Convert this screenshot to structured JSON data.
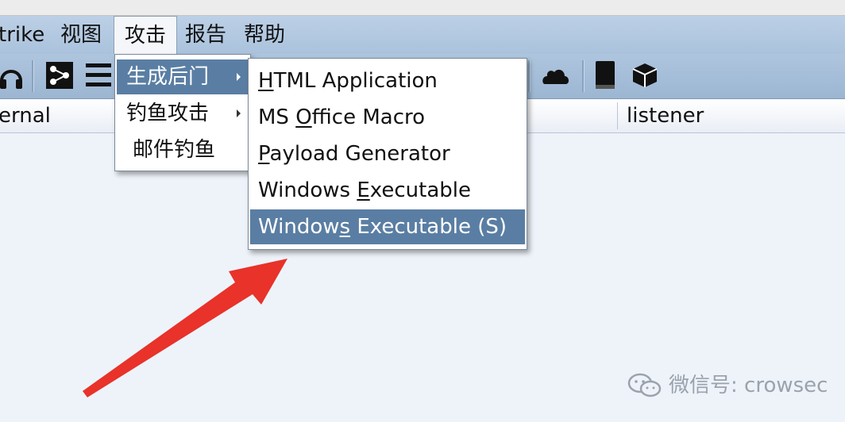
{
  "menubar": {
    "items": [
      {
        "label": "trike"
      },
      {
        "label": "视图"
      },
      {
        "label": "攻击"
      },
      {
        "label": "报告"
      },
      {
        "label": "帮助"
      }
    ]
  },
  "toolbar": {
    "icons": [
      "headset-icon",
      "network-graph-icon",
      "list-icon",
      "terminal-icon",
      "link-icon",
      "cloud-icon",
      "book-icon",
      "cube-icon"
    ]
  },
  "table": {
    "columns": [
      "ernal",
      "listener"
    ]
  },
  "attack_menu": {
    "items": [
      {
        "label": "生成后门",
        "has_submenu": true,
        "selected": true
      },
      {
        "label": "钓鱼攻击",
        "has_submenu": true,
        "selected": false
      },
      {
        "label": "邮件钓鱼",
        "has_submenu": false,
        "selected": false
      }
    ]
  },
  "backdoor_submenu": {
    "items": [
      {
        "pre": "",
        "mn": "H",
        "post": "TML Application",
        "selected": false
      },
      {
        "pre": "MS ",
        "mn": "O",
        "post": "ffice Macro",
        "selected": false
      },
      {
        "pre": "",
        "mn": "P",
        "post": "ayload Generator",
        "selected": false
      },
      {
        "pre": "Windows ",
        "mn": "E",
        "post": "xecutable",
        "selected": false
      },
      {
        "pre": "Window",
        "mn": "s",
        "post": " Executable (S)",
        "selected": true
      }
    ]
  },
  "watermark": {
    "text": "微信号: crowsec"
  },
  "colors": {
    "selection": "#5a7ea3",
    "annotation_arrow": "#e8322a",
    "menubar": "#aec5de"
  }
}
